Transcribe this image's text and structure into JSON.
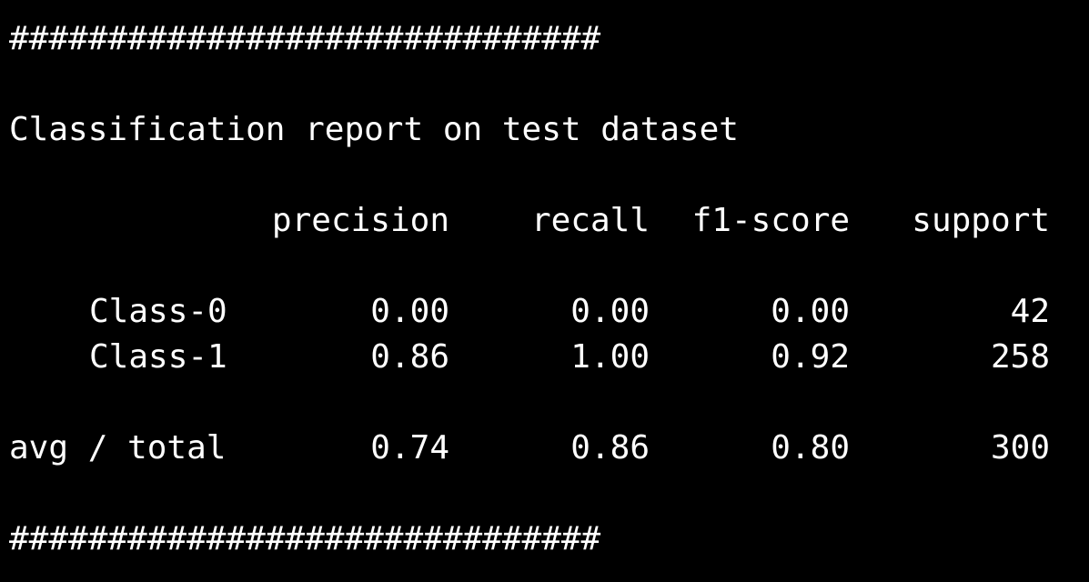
{
  "terminal": {
    "separator_top": "##############################",
    "report_title": "Classification report on test dataset",
    "separator_bottom": "##############################"
  },
  "report": {
    "headers": [
      "precision",
      "recall",
      "f1-score",
      "support"
    ],
    "rows": [
      {
        "label": "Class-0",
        "precision": "0.00",
        "recall": "0.00",
        "f1_score": "0.00",
        "support": "42"
      },
      {
        "label": "Class-1",
        "precision": "0.86",
        "recall": "1.00",
        "f1_score": "0.92",
        "support": "258"
      }
    ],
    "total": {
      "label": "avg / total",
      "precision": "0.74",
      "recall": "0.86",
      "f1_score": "0.80",
      "support": "300"
    }
  }
}
